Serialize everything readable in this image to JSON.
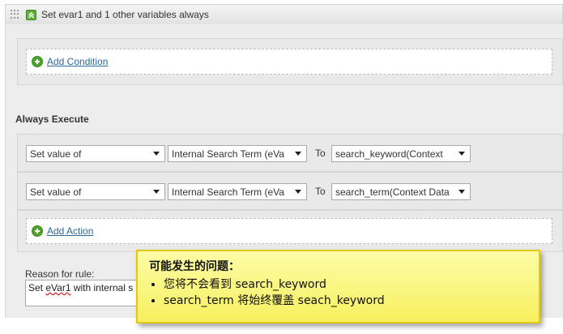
{
  "header": {
    "title": "Set evar1 and 1 other variables always",
    "icons": [
      "drag-grip-icon",
      "collapse-icon"
    ]
  },
  "conditions": {
    "add_condition_label": "Add Condition"
  },
  "always_execute": {
    "title": "Always Execute",
    "actions": [
      {
        "action": "Set value of",
        "variable": "Internal Search Term (eVa",
        "to_label": "To",
        "value": "search_keyword(Context"
      },
      {
        "action": "Set value of",
        "variable": "Internal Search Term (eVa",
        "to_label": "To",
        "value": "search_term(Context Data"
      }
    ],
    "add_action_label": "Add Action"
  },
  "reason": {
    "label": "Reason for rule:",
    "value_prefix": "Set ",
    "value_misspelled": "eVar1",
    "value_suffix": " with internal s"
  },
  "callout": {
    "title": "可能发生的问题：",
    "items": [
      "您将不会看到 search_keyword",
      "search_term 将始终覆盖 seach_keyword"
    ]
  },
  "colors": {
    "accent_green": "#4fa32d",
    "link": "#2a6a99",
    "callout_yellow": "#f7f05f"
  }
}
